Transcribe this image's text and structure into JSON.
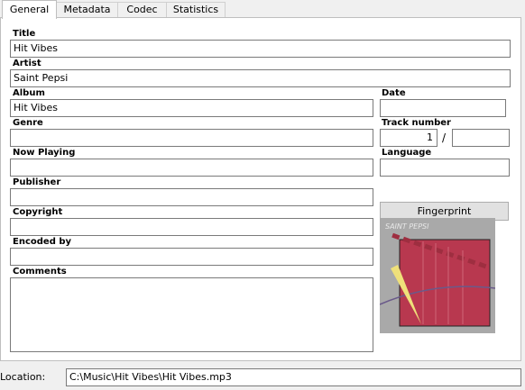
{
  "tabs": [
    {
      "label": "General",
      "active": true
    },
    {
      "label": "Metadata",
      "active": false
    },
    {
      "label": "Codec",
      "active": false
    },
    {
      "label": "Statistics",
      "active": false
    }
  ],
  "labels": {
    "title": "Title",
    "artist": "Artist",
    "album": "Album",
    "date": "Date",
    "genre": "Genre",
    "track_number": "Track number",
    "now_playing": "Now Playing",
    "language": "Language",
    "publisher": "Publisher",
    "copyright": "Copyright",
    "encoded_by": "Encoded by",
    "comments": "Comments",
    "location": "Location:"
  },
  "values": {
    "title": "Hit Vibes",
    "artist": "Saint Pepsi",
    "album": "Hit Vibes",
    "date": "",
    "genre": "",
    "track_number": "1",
    "track_total": "",
    "now_playing": "",
    "language": "",
    "publisher": "",
    "copyright": "",
    "encoded_by": "",
    "comments": "",
    "location": "C:\\Music\\Hit Vibes\\Hit Vibes.mp3"
  },
  "track_separator": "/",
  "buttons": {
    "fingerprint": "Fingerprint"
  },
  "album_art": {
    "caption": "SAINT PEPSI",
    "colors": {
      "background": "#a9a9a9",
      "square": "#b8384f",
      "accent": "#efe07a"
    }
  }
}
